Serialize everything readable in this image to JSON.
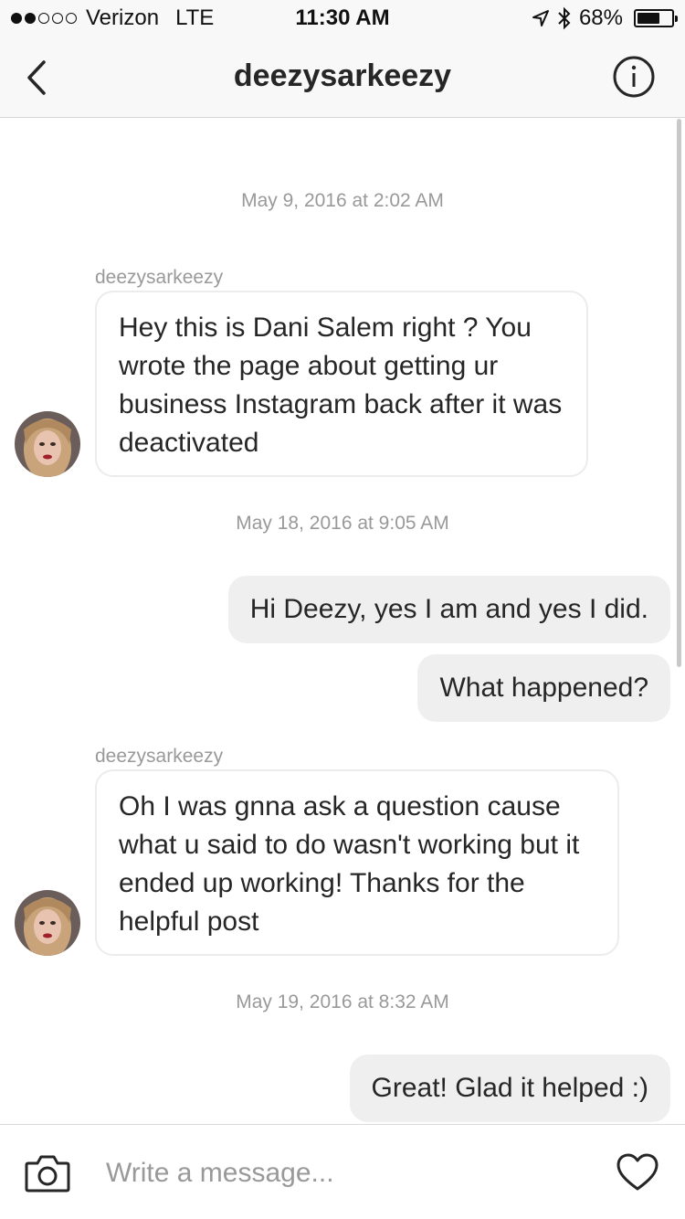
{
  "status_bar": {
    "signal_dots_filled": 2,
    "signal_dots_total": 5,
    "carrier": "Verizon",
    "network": "LTE",
    "time": "11:30 AM",
    "battery_pct": "68%",
    "battery_level": 0.68,
    "icons": [
      "location-arrow-icon",
      "bluetooth-icon",
      "battery-icon"
    ]
  },
  "nav": {
    "title": "deezysarkeezy",
    "back_icon": "chevron-left-icon",
    "info_icon": "info-circle-icon"
  },
  "messages": {
    "ts1": "May 9, 2016 at 2:02 AM",
    "sender1": "deezysarkeezy",
    "in1": "Hey this is Dani Salem right ? You wrote the page about getting ur business Instagram back after it was deactivated",
    "ts2": "May 18, 2016 at 9:05 AM",
    "out1": "Hi Deezy, yes I am and yes I did.",
    "out2": "What happened?",
    "sender2": "deezysarkeezy",
    "in2": "Oh I was gnna ask a question cause what u said to do wasn't working but it ended up working! Thanks for the helpful post",
    "ts3": "May 19, 2016 at 8:32 AM",
    "out3": "Great! Glad it helped :)"
  },
  "compose": {
    "placeholder": "Write a message...",
    "camera_icon": "camera-icon",
    "heart_icon": "heart-icon"
  },
  "colors": {
    "bar_bg": "#f8f8f8",
    "outgoing_bubble": "#efefef",
    "incoming_border": "#ececec",
    "meta_text": "#999999"
  }
}
